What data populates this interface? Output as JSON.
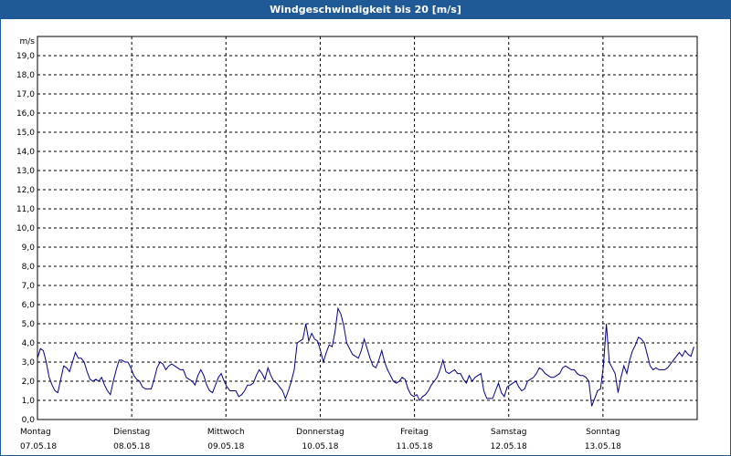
{
  "window": {
    "title": "Windgeschwindigkeit bis 20 [m/s]"
  },
  "chart_data": {
    "type": "line",
    "title": "Windgeschwindigkeit bis 20 [m/s]",
    "ylabel": "m/s",
    "xlabel": "",
    "ylim": [
      0,
      20
    ],
    "yticks": [
      "0,0",
      "1,0",
      "2,0",
      "3,0",
      "4,0",
      "5,0",
      "6,0",
      "7,0",
      "8,0",
      "9,0",
      "10,0",
      "11,0",
      "12,0",
      "13,0",
      "14,0",
      "15,0",
      "16,0",
      "17,0",
      "18,0",
      "19,0"
    ],
    "xlim": [
      0,
      7
    ],
    "days": [
      {
        "name": "Montag",
        "date": "07.05.18"
      },
      {
        "name": "Dienstag",
        "date": "08.05.18"
      },
      {
        "name": "Mittwoch",
        "date": "09.05.18"
      },
      {
        "name": "Donnerstag",
        "date": "10.05.18"
      },
      {
        "name": "Freitag",
        "date": "11.05.18"
      },
      {
        "name": "Samstag",
        "date": "12.05.18"
      },
      {
        "name": "Sonntag",
        "date": "13.05.18"
      }
    ],
    "grid": true,
    "line_color": "#00008b",
    "series": [
      {
        "values": [
          3.2,
          3.7,
          3.6,
          3.0,
          2.2,
          1.8,
          1.5,
          1.4,
          2.1,
          2.8,
          2.7,
          2.5,
          3.0,
          3.5,
          3.2,
          3.2,
          3.0,
          2.5,
          2.1,
          2.0,
          2.1,
          2.0,
          2.2,
          1.8,
          1.5,
          1.3,
          2.0,
          2.6,
          3.1,
          3.1,
          3.0,
          3.0,
          2.7,
          2.3,
          2.1,
          2.0,
          1.7,
          1.6,
          1.6,
          1.6,
          2.1,
          2.7,
          3.0,
          2.9,
          2.6,
          2.8,
          2.9,
          2.8,
          2.7,
          2.6,
          2.6,
          2.2,
          2.1,
          2.0,
          1.8,
          2.3,
          2.6,
          2.3,
          1.8,
          1.5,
          1.4,
          1.8,
          2.2,
          2.4,
          2.0,
          1.7,
          1.5,
          1.5,
          1.5,
          1.2,
          1.3,
          1.5,
          1.8,
          1.8,
          1.9,
          2.3,
          2.6,
          2.4,
          2.1,
          2.7,
          2.3,
          2.0,
          1.9,
          1.7,
          1.5,
          1.1,
          1.5,
          2.0,
          2.6,
          4.0,
          4.1,
          4.2,
          5.0,
          4.1,
          4.5,
          4.2,
          4.1,
          3.6,
          3.0,
          3.5,
          3.9,
          3.8,
          4.6,
          5.8,
          5.5,
          4.9,
          4.0,
          3.7,
          3.4,
          3.3,
          3.2,
          3.6,
          4.2,
          3.7,
          3.2,
          2.8,
          2.7,
          3.1,
          3.6,
          3.0,
          2.6,
          2.3,
          2.0,
          1.9,
          2.0,
          2.2,
          2.1,
          1.6,
          1.3,
          1.2,
          1.3,
          1.0,
          1.2,
          1.3,
          1.5,
          1.8,
          2.0,
          2.2,
          2.6,
          3.1,
          2.5,
          2.4,
          2.5,
          2.6,
          2.4,
          2.4,
          2.1,
          1.9,
          2.3,
          2.0,
          2.2,
          2.3,
          2.4,
          1.5,
          1.1,
          1.1,
          1.1,
          1.5,
          1.9,
          1.4,
          1.2,
          1.7,
          1.8,
          1.9,
          2.0,
          1.7,
          1.5,
          1.6,
          2.0,
          2.1,
          2.2,
          2.4,
          2.7,
          2.6,
          2.4,
          2.3,
          2.2,
          2.2,
          2.3,
          2.4,
          2.7,
          2.8,
          2.7,
          2.6,
          2.6,
          2.4,
          2.3,
          2.3,
          2.2,
          2.0,
          0.7,
          1.1,
          1.5,
          1.6,
          2.8,
          5.0,
          3.0,
          2.7,
          2.4,
          1.4,
          2.2,
          2.8,
          2.4,
          3.1,
          3.6,
          3.9,
          4.3,
          4.2,
          4.0,
          3.4,
          2.8,
          2.6,
          2.7,
          2.6,
          2.6,
          2.6,
          2.7,
          2.9,
          3.1,
          3.3,
          3.5,
          3.3,
          3.6,
          3.4,
          3.3,
          3.8
        ]
      }
    ]
  }
}
